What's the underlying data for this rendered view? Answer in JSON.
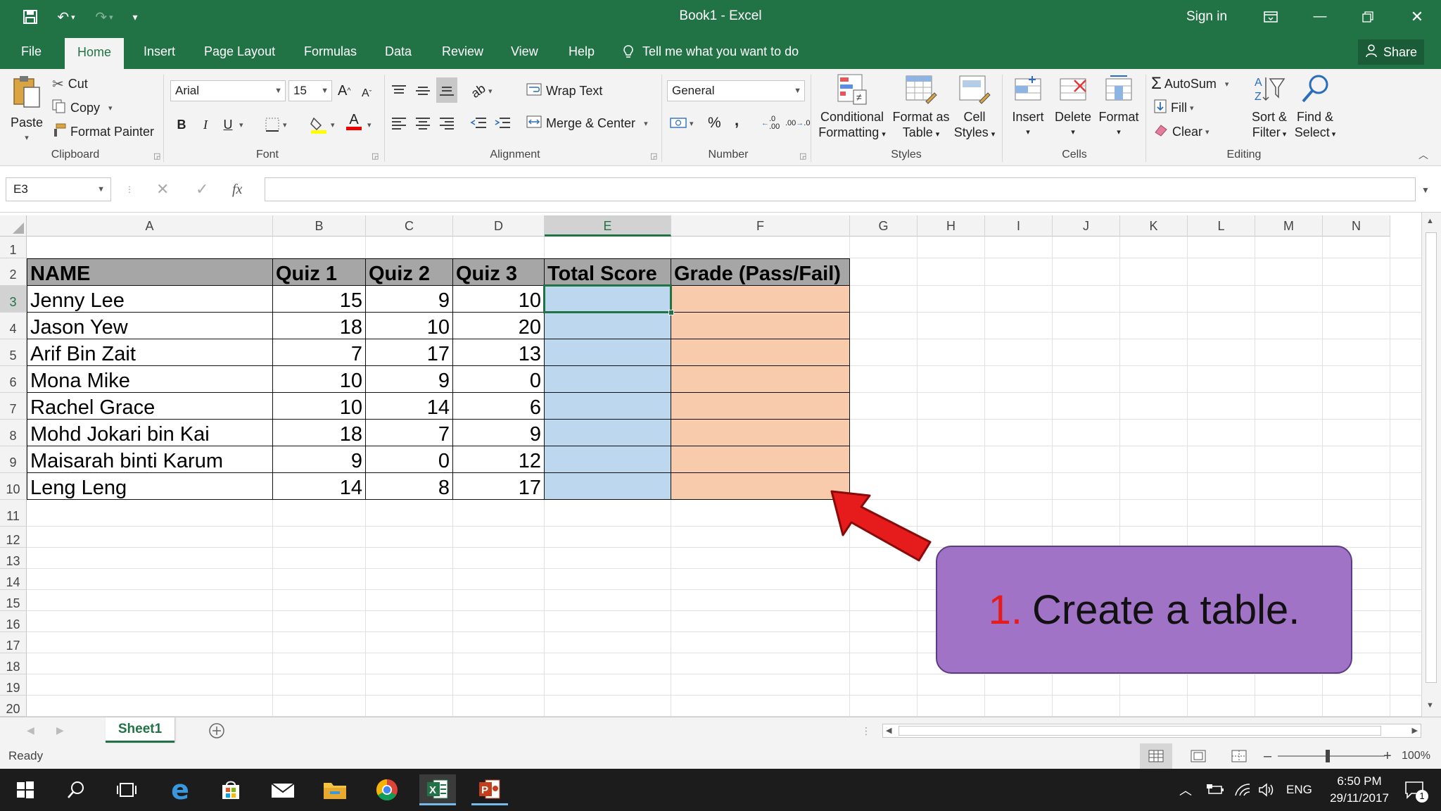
{
  "window": {
    "title": "Book1  -  Excel",
    "sign_in": "Sign in"
  },
  "menu": {
    "tabs": [
      "File",
      "Home",
      "Insert",
      "Page Layout",
      "Formulas",
      "Data",
      "Review",
      "View",
      "Help"
    ],
    "tell_me": "Tell me what you want to do",
    "share": "Share"
  },
  "ribbon": {
    "clipboard": {
      "paste": "Paste",
      "cut": "Cut",
      "copy": "Copy",
      "format_painter": "Format Painter",
      "label": "Clipboard"
    },
    "font": {
      "name": "Arial",
      "size": "15",
      "bold": "B",
      "italic": "I",
      "underline": "U",
      "label": "Font"
    },
    "alignment": {
      "wrap_text": "Wrap Text",
      "merge_center": "Merge & Center",
      "label": "Alignment"
    },
    "number": {
      "format": "General",
      "percent": "%",
      "comma": ",",
      "label": "Number"
    },
    "styles": {
      "conditional_1": "Conditional",
      "conditional_2": "Formatting",
      "format_table_1": "Format as",
      "format_table_2": "Table",
      "cell_styles_1": "Cell",
      "cell_styles_2": "Styles",
      "label": "Styles"
    },
    "cells": {
      "insert": "Insert",
      "delete": "Delete",
      "format": "Format",
      "label": "Cells"
    },
    "editing": {
      "autosum": "AutoSum",
      "fill": "Fill",
      "clear": "Clear",
      "sort_1": "Sort &",
      "sort_2": "Filter",
      "find_1": "Find &",
      "find_2": "Select",
      "label": "Editing"
    }
  },
  "formula_bar": {
    "name_box": "E3",
    "fx": "fx",
    "value": ""
  },
  "grid": {
    "columns": [
      "A",
      "B",
      "C",
      "D",
      "E",
      "F",
      "G",
      "H",
      "I",
      "J",
      "K",
      "L",
      "M",
      "N"
    ],
    "rows": [
      "1",
      "2",
      "3",
      "4",
      "5",
      "6",
      "7",
      "8",
      "9",
      "10",
      "11",
      "12",
      "13",
      "14",
      "15",
      "16",
      "17",
      "18",
      "19",
      "20"
    ],
    "headers": [
      "NAME",
      "Quiz 1",
      "Quiz 2",
      "Quiz 3",
      "Total Score",
      "Grade (Pass/Fail)"
    ],
    "data": [
      {
        "name": "Jenny Lee",
        "q1": "15",
        "q2": "9",
        "q3": "10"
      },
      {
        "name": "Jason Yew",
        "q1": "18",
        "q2": "10",
        "q3": "20"
      },
      {
        "name": "Arif Bin Zait",
        "q1": "7",
        "q2": "17",
        "q3": "13"
      },
      {
        "name": "Mona Mike",
        "q1": "10",
        "q2": "9",
        "q3": "0"
      },
      {
        "name": "Rachel Grace",
        "q1": "10",
        "q2": "14",
        "q3": "6"
      },
      {
        "name": "Mohd Jokari bin Kai",
        "q1": "18",
        "q2": "7",
        "q3": "9"
      },
      {
        "name": "Maisarah binti Karum",
        "q1": "9",
        "q2": "0",
        "q3": "12"
      },
      {
        "name": "Leng Leng",
        "q1": "14",
        "q2": "8",
        "q3": "17"
      }
    ],
    "selected_cell": "E3"
  },
  "sheets": {
    "active": "Sheet1"
  },
  "status": {
    "ready": "Ready",
    "zoom": "100%"
  },
  "taskbar": {
    "time": "6:50 PM",
    "date": "29/11/2017",
    "lang": "ENG",
    "notification_count": "1"
  },
  "annotation": {
    "number": "1.",
    "text": "Create a table."
  },
  "colors": {
    "excel_green": "#217346",
    "header_gray": "#a6a6a6",
    "total_blue": "#bdd7ee",
    "grade_orange": "#f8cbad",
    "callout_purple": "#a173c6",
    "arrow_red": "#e61b1b"
  },
  "icons": [
    "save-icon",
    "undo-icon",
    "redo-icon",
    "customize-qa-icon",
    "ribbon-display-icon",
    "minimize-icon",
    "restore-icon",
    "close-icon",
    "lightbulb-icon",
    "share-person-icon",
    "paste-icon",
    "cut-icon",
    "copy-icon",
    "format-painter-icon",
    "autosum-icon",
    "sort-filter-icon",
    "find-icon",
    "windows-start-icon",
    "search-icon",
    "task-view-icon",
    "edge-icon",
    "store-icon",
    "mail-icon",
    "file-explorer-icon",
    "chrome-icon",
    "excel-icon",
    "powerpoint-icon",
    "red-arrow-icon"
  ]
}
